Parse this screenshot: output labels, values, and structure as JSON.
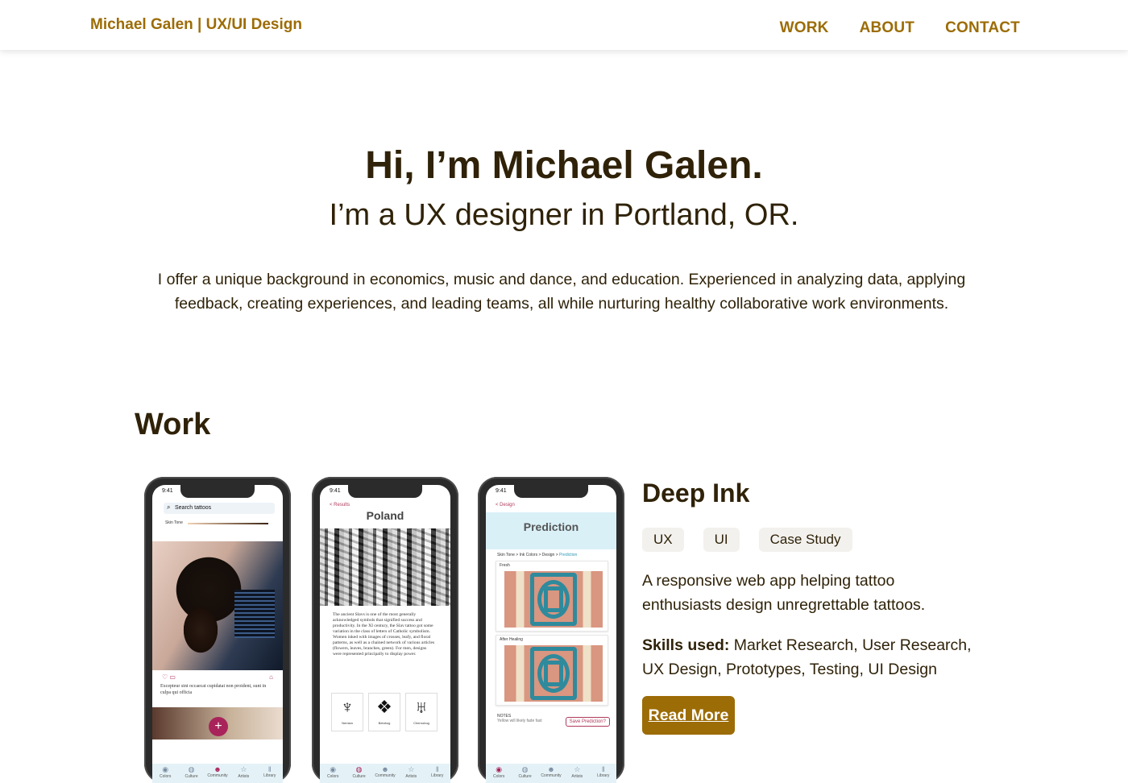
{
  "header": {
    "brand": "Michael Galen | UX/UI Design",
    "nav": [
      "WORK",
      "ABOUT",
      "CONTACT"
    ]
  },
  "hero": {
    "title": "Hi, I’m Michael Galen.",
    "subtitle": "I’m a UX designer in Portland, OR.",
    "body": "I offer a unique background in economics, music and dance, and education. Experienced in analyzing data, applying feedback, creating experiences, and leading teams, all while nurturing healthy collaborative work environments."
  },
  "work": {
    "heading": "Work",
    "project": {
      "title": "Deep Ink",
      "tags": [
        "UX",
        "UI",
        "Case Study"
      ],
      "description": "A responsive web app helping tattoo enthusiasts design unregrettable tattoos.",
      "skills_label": "Skills used:",
      "skills": "Market Research, User Research, UX Design, Prototypes, Testing, UI Design",
      "cta": "Read More"
    },
    "mockups": {
      "time": "9:41",
      "phone1": {
        "search_placeholder": "Search tattoos",
        "skin_tone": "Skin Tone",
        "caption": "Excepteur sint occaecat cupidatat non proident, sunt in culpa qui officia"
      },
      "phone2": {
        "back": "< Results",
        "title": "Poland",
        "body": "The ancient Slavs is one of the most generally acknowledged symbols that signified success and productivity. In the XI century, the Slav tattoo got some variation in the class of letters of Catholic symbolism. Women inked with images of crosses, leafy, and floral patterns, as well as a chained network of various articles (flowers, leaves, branches, green). For men, designs were represented principally to display power.",
        "symbols": [
          "Nemiza",
          "Belobog",
          "Chernobog"
        ]
      },
      "phone3": {
        "back": "< Design",
        "title": "Prediction",
        "crumbs": "Skin Tone > Ink Colors > Design >",
        "crumb_active": "Prediction",
        "fresh": "Fresh",
        "after_healing": "After Healing",
        "notes": "NOTES",
        "notes_text": "Yellow will likely fade fast",
        "save": "Save Prediction?"
      },
      "tabs": [
        "Colors",
        "Culture",
        "Community",
        "Artists",
        "Library"
      ]
    }
  },
  "colors": {
    "accent": "#9c6c06",
    "text": "#2f2208",
    "tag_bg": "#f2f1ee"
  }
}
